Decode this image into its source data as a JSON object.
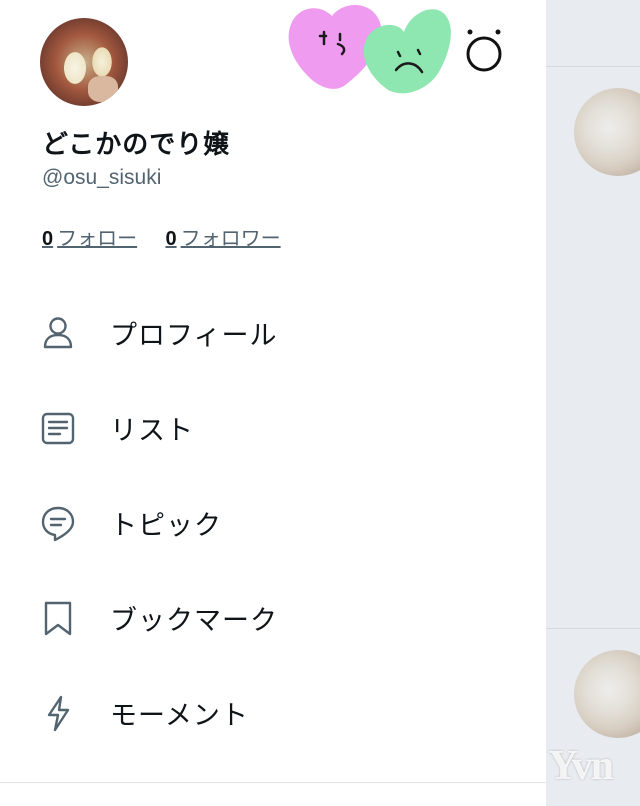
{
  "profile": {
    "display_name": "どこかのでり嬢",
    "handle": "@osu_sisuki"
  },
  "follow": {
    "following_count": "0",
    "following_label": "フォロー",
    "followers_count": "0",
    "followers_label": "フォロワー"
  },
  "menu": {
    "items": [
      {
        "label": "プロフィール",
        "icon": "person-icon"
      },
      {
        "label": "リスト",
        "icon": "list-icon"
      },
      {
        "label": "トピック",
        "icon": "topic-bubble-icon"
      },
      {
        "label": "ブックマーク",
        "icon": "bookmark-icon"
      },
      {
        "label": "モーメント",
        "icon": "lightning-icon"
      }
    ]
  },
  "stickers": [
    "pink-heart-face-sticker",
    "green-heart-face-sticker",
    "face-doodle-sticker"
  ],
  "colors": {
    "text": "#0f1419",
    "secondary": "#536471",
    "icon": "#536471",
    "backdrop": "#e8ebf0",
    "pink_sticker": "#ee9bf0",
    "green_sticker": "#8ee6b0"
  },
  "watermark": {
    "text": "Yvn"
  }
}
